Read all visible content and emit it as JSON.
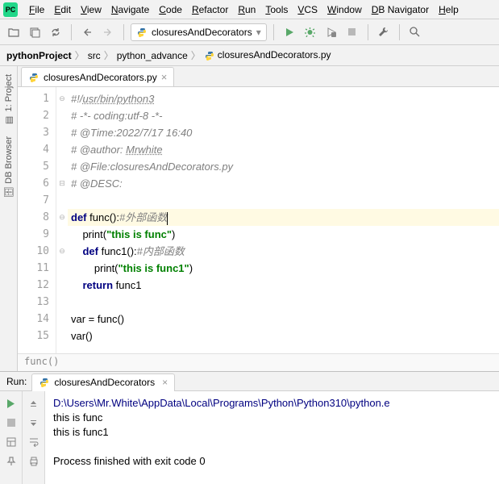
{
  "menu": {
    "items": [
      "File",
      "Edit",
      "View",
      "Navigate",
      "Code",
      "Refactor",
      "Run",
      "Tools",
      "VCS",
      "Window",
      "DB Navigator",
      "Help"
    ]
  },
  "toolbar": {
    "run_config": "closuresAndDecorators"
  },
  "breadcrumbs": {
    "items": [
      "pythonProject",
      "src",
      "python_advance",
      "closuresAndDecorators.py"
    ]
  },
  "left_rail": {
    "tabs": [
      "1: Project",
      "DB Browser"
    ]
  },
  "editor": {
    "tab_name": "closuresAndDecorators.py",
    "lines": [
      {
        "n": 1,
        "seg": [
          {
            "t": "#!/",
            "c": "comment"
          },
          {
            "t": "usr/bin/python3",
            "c": "url"
          }
        ]
      },
      {
        "n": 2,
        "seg": [
          {
            "t": "# -*- coding:utf-8 -*-",
            "c": "comment"
          }
        ]
      },
      {
        "n": 3,
        "seg": [
          {
            "t": "# @Time:2022/7/17 16:40",
            "c": "comment"
          }
        ]
      },
      {
        "n": 4,
        "seg": [
          {
            "t": "# @author: ",
            "c": "comment"
          },
          {
            "t": "Mrwhite",
            "c": "url"
          }
        ]
      },
      {
        "n": 5,
        "seg": [
          {
            "t": "# @File:closuresAndDecorators.py",
            "c": "comment"
          }
        ]
      },
      {
        "n": 6,
        "seg": [
          {
            "t": "# @DESC:",
            "c": "comment"
          }
        ]
      },
      {
        "n": 7,
        "seg": []
      },
      {
        "n": 8,
        "hl": true,
        "seg": [
          {
            "t": "def ",
            "c": "kw"
          },
          {
            "t": "func",
            "c": "fn"
          },
          {
            "t": "():",
            "c": ""
          },
          {
            "t": "#外部函数",
            "c": "comment"
          }
        ]
      },
      {
        "n": 9,
        "seg": [
          {
            "t": "    print(",
            "c": ""
          },
          {
            "t": "\"this is func\"",
            "c": "str"
          },
          {
            "t": ")",
            "c": ""
          }
        ]
      },
      {
        "n": 10,
        "seg": [
          {
            "t": "    ",
            "c": ""
          },
          {
            "t": "def ",
            "c": "kw"
          },
          {
            "t": "func1",
            "c": "fn"
          },
          {
            "t": "():",
            "c": ""
          },
          {
            "t": "#内部函数",
            "c": "comment"
          }
        ]
      },
      {
        "n": 11,
        "seg": [
          {
            "t": "        print(",
            "c": ""
          },
          {
            "t": "\"this is func1\"",
            "c": "str"
          },
          {
            "t": ")",
            "c": ""
          }
        ]
      },
      {
        "n": 12,
        "seg": [
          {
            "t": "    ",
            "c": ""
          },
          {
            "t": "return ",
            "c": "kw"
          },
          {
            "t": "func1",
            "c": ""
          }
        ]
      },
      {
        "n": 13,
        "seg": []
      },
      {
        "n": 14,
        "seg": [
          {
            "t": "var = func()",
            "c": ""
          }
        ]
      },
      {
        "n": 15,
        "seg": [
          {
            "t": "var()",
            "c": ""
          }
        ]
      }
    ],
    "fold": {
      "1": "⊖",
      "6": "⊟",
      "8": "⊖",
      "10": "⊖"
    },
    "crumb": "func()"
  },
  "run": {
    "label": "Run:",
    "tab": "closuresAndDecorators",
    "output": [
      {
        "t": "D:\\Users\\Mr.White\\AppData\\Local\\Programs\\Python\\Python310\\python.e",
        "cls": "out-path"
      },
      {
        "t": "this is func",
        "cls": ""
      },
      {
        "t": "this is func1",
        "cls": ""
      },
      {
        "t": "",
        "cls": ""
      },
      {
        "t": "Process finished with exit code 0",
        "cls": ""
      }
    ]
  }
}
